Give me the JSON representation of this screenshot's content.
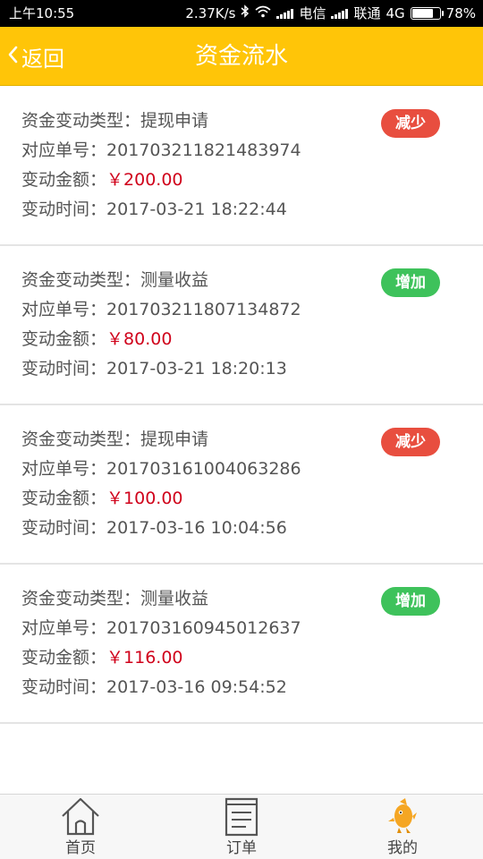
{
  "status_bar": {
    "time": "上午10:55",
    "speed": "2.37K/s",
    "carrier1": "电信",
    "carrier2": "联通",
    "network": "4G",
    "battery": "78%",
    "battery_level": 0.78
  },
  "header": {
    "back_label": "返回",
    "title": "资金流水",
    "background": "#ffc508"
  },
  "labels": {
    "type": "资金变动类型：",
    "order_no": "对应单号：",
    "amount": "变动金额：",
    "time": "变动时间："
  },
  "records": [
    {
      "type": "提现申请",
      "order_no": "201703211821483974",
      "amount": "￥200.00",
      "time": "2017-03-21 18:22:44",
      "badge": "减少",
      "badge_kind": "decrease"
    },
    {
      "type": "测量收益",
      "order_no": "201703211807134872",
      "amount": "￥80.00",
      "time": "2017-03-21 18:20:13",
      "badge": "增加",
      "badge_kind": "increase"
    },
    {
      "type": "提现申请",
      "order_no": "201703161004063286",
      "amount": "￥100.00",
      "time": "2017-03-16 10:04:56",
      "badge": "减少",
      "badge_kind": "decrease"
    },
    {
      "type": "测量收益",
      "order_no": "201703160945012637",
      "amount": "￥116.00",
      "time": "2017-03-16 09:54:52",
      "badge": "增加",
      "badge_kind": "increase"
    }
  ],
  "colors": {
    "amount": "#d0021b",
    "decrease_badge": "#e84e3f",
    "increase_badge": "#3ec25b",
    "accent": "#ffc508"
  },
  "bottom_nav": [
    {
      "label": "首页",
      "icon": "home-icon"
    },
    {
      "label": "订单",
      "icon": "order-list-icon"
    },
    {
      "label": "我的",
      "icon": "mascot-icon"
    }
  ]
}
